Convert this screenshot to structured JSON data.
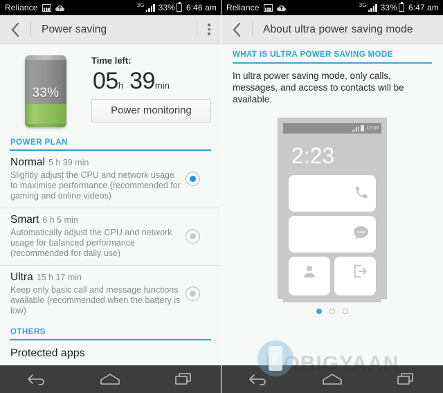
{
  "left": {
    "status_bar": {
      "carrier": "Reliance",
      "icons": [
        "image-icon",
        "cloud-upload-icon"
      ],
      "network": "3G",
      "signal": "signal-bars-icon",
      "battery_percent": "33%",
      "battery_icon": "battery-icon",
      "time": "6:46 am"
    },
    "action_bar": {
      "back": "back-arrow-icon",
      "title": "Power saving",
      "overflow": "overflow-menu-icon"
    },
    "battery_summary": {
      "battery_percent_label": "33%",
      "battery_level": 33,
      "time_left_label": "Time left:",
      "hours": "05",
      "hours_unit": "h",
      "minutes": "39",
      "minutes_unit": "min",
      "power_monitoring_button": "Power monitoring"
    },
    "power_plan": {
      "section_title": "POWER PLAN",
      "options": [
        {
          "name": "Normal",
          "time": "5 h 39 min",
          "description": "Slightly adjust the CPU and network usage to maximise performance (recommended for gaming and online videos)",
          "selected": true
        },
        {
          "name": "Smart",
          "time": "6 h 5 min",
          "description": "Automatically adjust the CPU and network usage for balanced performance (recommended for daily use)",
          "selected": false
        },
        {
          "name": "Ultra",
          "time": "15 h 17 min",
          "description": "Keep only basic call and message functions available (recommended when the battery is low)",
          "selected": false
        }
      ]
    },
    "others": {
      "section_title": "OTHERS",
      "items": [
        "Protected apps"
      ]
    }
  },
  "right": {
    "status_bar": {
      "carrier": "Reliance",
      "icons": [
        "image-icon",
        "cloud-upload-icon"
      ],
      "network": "3G",
      "battery_percent": "33%",
      "time": "6:47 am"
    },
    "action_bar": {
      "back": "back-arrow-icon",
      "title": "About ultra power saving mode"
    },
    "info": {
      "section_title": "WHAT IS ULTRA POWER SAVING MODE",
      "body": "In ultra power saving mode, only calls, messages, and access to contacts will be available."
    },
    "preview": {
      "status_time": "12:00",
      "clock": "2:23",
      "tiles": [
        "phone-icon",
        "message-icon",
        "contacts-icon",
        "exit-icon"
      ]
    },
    "pager": {
      "count": 3,
      "active": 0
    }
  },
  "watermark": {
    "text": "MOBIGYAAN"
  },
  "nav_bar": {
    "buttons": [
      "back-nav-icon",
      "home-nav-icon",
      "recents-nav-icon"
    ]
  },
  "colors": {
    "accent": "#2aa5d6",
    "battery_green": "#91c05c",
    "status_bar_bg": "#000000",
    "action_bar_bg": "#e8e8e8",
    "nav_bar_bg": "#3d3d3d"
  }
}
